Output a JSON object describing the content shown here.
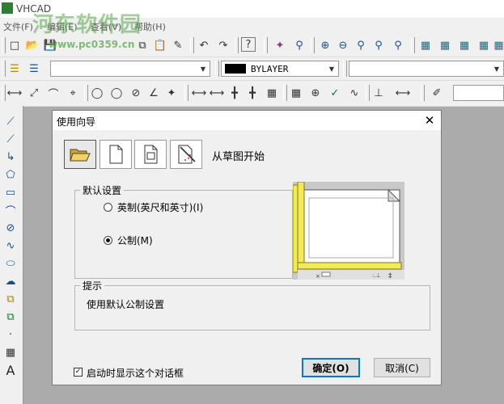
{
  "app": {
    "title": "VHCAD"
  },
  "menu": [
    "文件(F)",
    "编辑(E)",
    "查看(V)",
    "帮助(H)"
  ],
  "watermark": {
    "main": "河东软件园",
    "sub": "www.pc0359.cn"
  },
  "toolbar": {
    "layer_combo_value": "",
    "color_combo_value": "BYLAYER",
    "linetype_combo_value": ""
  },
  "dialog": {
    "title": "使用向导",
    "wizard_label": "从草图开始",
    "default_group_label": "默认设置",
    "radio_imperial": "英制(英尺和英寸)(I)",
    "radio_metric": "公制(M)",
    "selected": "metric",
    "hint_group_label": "提示",
    "hint_text": "使用默认公制设置",
    "show_on_startup_label": "启动时显示这个对话框",
    "show_on_startup_checked": true,
    "ok_label": "确定(O)",
    "cancel_label": "取消(C)"
  },
  "colors": {
    "accent": "#0078d7",
    "ruler": "#f2e95c",
    "watermark": "#5aa84e"
  }
}
